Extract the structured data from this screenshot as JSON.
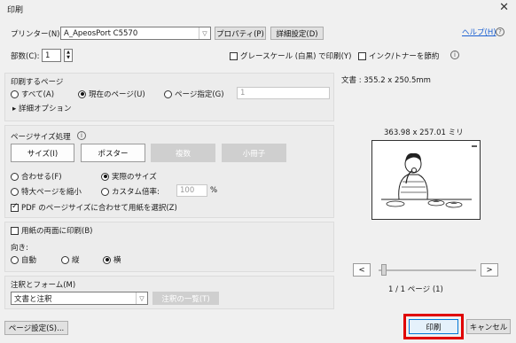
{
  "window": {
    "title": "印刷",
    "close": "✕"
  },
  "printer": {
    "label": "プリンター(N):",
    "value": "A_ApeosPort C5570",
    "properties": "プロパティ(P)",
    "advanced": "詳細設定(D)",
    "help": "ヘルプ(H)",
    "help_icon": "?"
  },
  "copies": {
    "label": "部数(C):",
    "value": "1"
  },
  "options": {
    "grayscale": "グレースケール (白黒) で印刷(Y)",
    "grayscale_checked": false,
    "save_ink": "インク/トナーを節約",
    "save_ink_checked": false,
    "info": "i"
  },
  "pages": {
    "heading": "印刷するページ",
    "all": "すべて(A)",
    "current": "現在のページ(U)",
    "specify": "ページ指定(G)",
    "range_value": "1",
    "selected": "current",
    "more": "▸ 詳細オプション"
  },
  "size": {
    "heading": "ページサイズ処理",
    "info": "i",
    "tabs": [
      "サイズ(I)",
      "ポスター",
      "複数",
      "小冊子"
    ],
    "active_tab": 0,
    "fit": "合わせる(F)",
    "actual": "実際のサイズ",
    "shrink": "特大ページを縮小",
    "custom": "カスタム倍率:",
    "custom_value": "100",
    "percent": "%",
    "selected": "actual",
    "pdf_paper": "PDF のページサイズに合わせて用紙を選択(Z)",
    "pdf_paper_checked": true
  },
  "duplex": {
    "label": "用紙の両面に印刷(B)",
    "checked": false
  },
  "orientation": {
    "label": "向き:",
    "auto": "自動",
    "portrait": "縦",
    "landscape": "横",
    "selected": "landscape"
  },
  "comments": {
    "label": "注釈とフォーム(M)",
    "value": "文書と注釈",
    "summary_button": "注釈の一覧(T)"
  },
  "preview": {
    "doc_label": "文書 : 355.2 x 250.5mm",
    "paper_label": "363.98 x 257.01 ミリ",
    "page_counter": "1 / 1 ページ (1)",
    "prev": "<",
    "next": ">"
  },
  "footer": {
    "page_setup": "ページ設定(S)...",
    "print": "印刷",
    "cancel": "キャンセル"
  },
  "colors": {
    "highlight": "#e00000",
    "link": "#1a5fd1"
  }
}
